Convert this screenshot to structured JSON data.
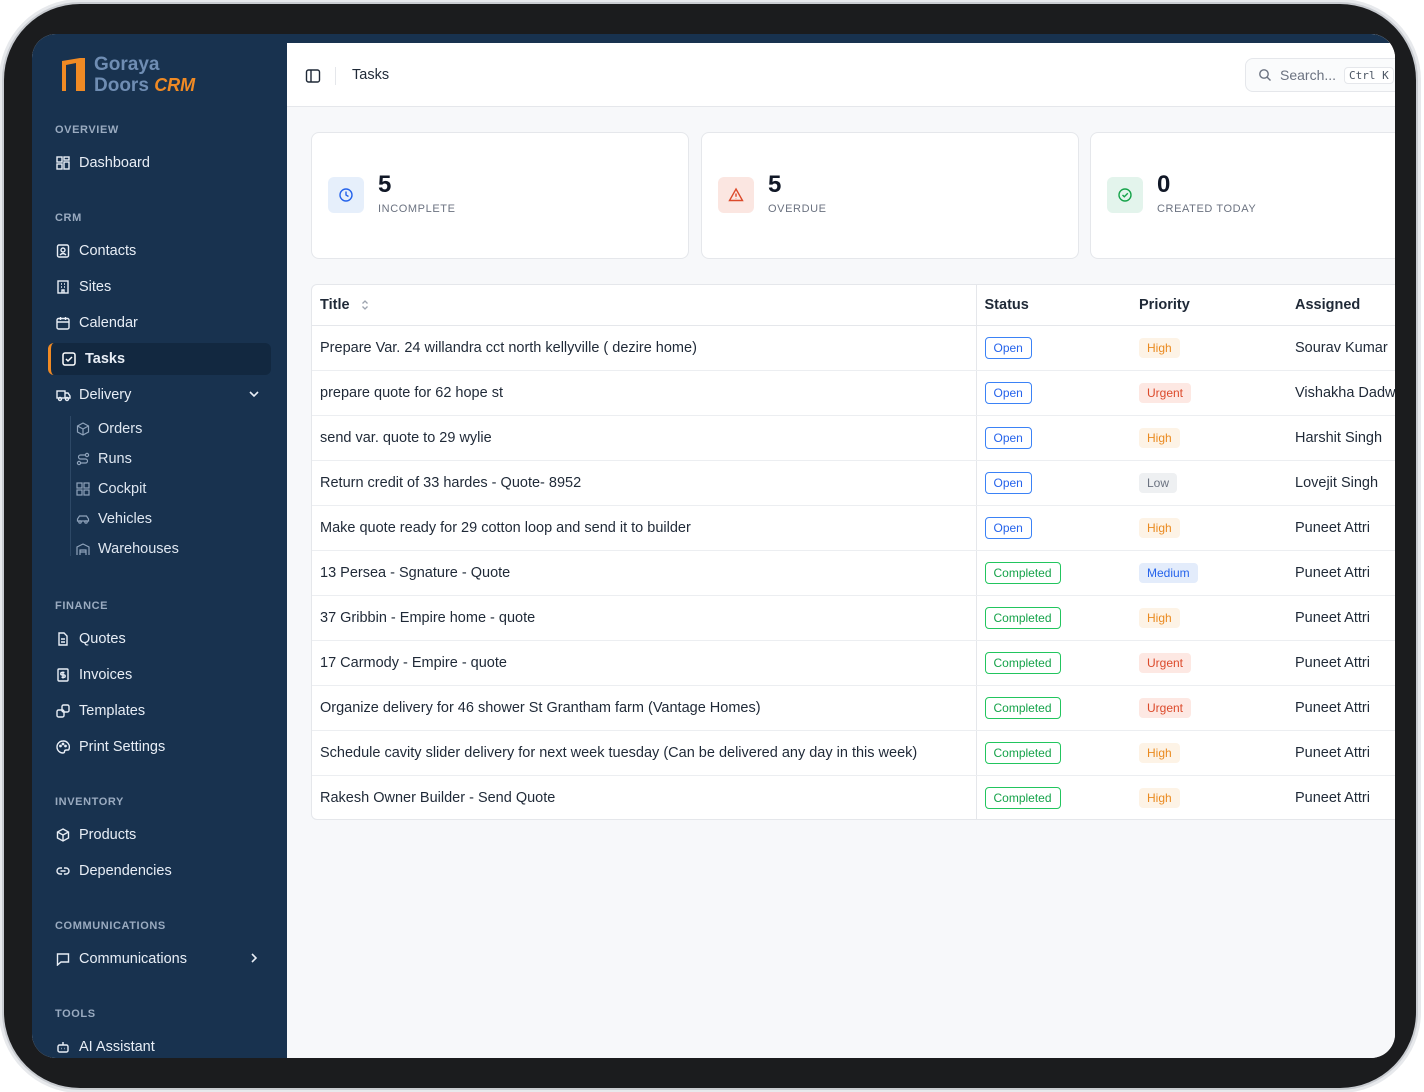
{
  "brand": {
    "line1": "Goraya",
    "line2": "Doors",
    "line2_accent": "CRM"
  },
  "sidebar": {
    "sections": {
      "overview": "OVERVIEW",
      "crm": "CRM",
      "finance": "FINANCE",
      "inventory": "INVENTORY",
      "communications": "COMMUNICATIONS",
      "tools": "TOOLS"
    },
    "items": {
      "dashboard": "Dashboard",
      "contacts": "Contacts",
      "sites": "Sites",
      "calendar": "Calendar",
      "tasks": "Tasks",
      "delivery": "Delivery",
      "orders": "Orders",
      "runs": "Runs",
      "cockpit": "Cockpit",
      "vehicles": "Vehicles",
      "warehouses": "Warehouses",
      "quotes": "Quotes",
      "invoices": "Invoices",
      "templates": "Templates",
      "print_settings": "Print Settings",
      "products": "Products",
      "dependencies": "Dependencies",
      "communications": "Communications",
      "ai_assistant": "AI Assistant"
    },
    "active": "tasks"
  },
  "header": {
    "title": "Tasks",
    "search_placeholder": "Search...",
    "shortcut": "Ctrl K"
  },
  "stats": [
    {
      "value": "5",
      "label": "INCOMPLETE",
      "icon": "clock-icon"
    },
    {
      "value": "5",
      "label": "OVERDUE",
      "icon": "alert-triangle-icon"
    },
    {
      "value": "0",
      "label": "CREATED TODAY",
      "icon": "check-circle-icon"
    }
  ],
  "table": {
    "columns": {
      "title": "Title",
      "status": "Status",
      "priority": "Priority",
      "assigned": "Assigned"
    },
    "rows": [
      {
        "title": "Prepare Var. 24 willandra cct north kellyville ( dezire home)",
        "status": "Open",
        "priority": "High",
        "assigned": "Sourav Kumar"
      },
      {
        "title": "prepare quote for 62 hope st",
        "status": "Open",
        "priority": "Urgent",
        "assigned": "Vishakha Dadw"
      },
      {
        "title": "send var. quote to 29 wylie",
        "status": "Open",
        "priority": "High",
        "assigned": "Harshit Singh"
      },
      {
        "title": "Return credit of 33 hardes - Quote- 8952",
        "status": "Open",
        "priority": "Low",
        "assigned": "Lovejit Singh"
      },
      {
        "title": "Make quote ready for 29 cotton loop and send it to builder",
        "status": "Open",
        "priority": "High",
        "assigned": "Puneet Attri"
      },
      {
        "title": "13 Persea - Sgnature - Quote",
        "status": "Completed",
        "priority": "Medium",
        "assigned": "Puneet Attri"
      },
      {
        "title": "37 Gribbin - Empire home - quote",
        "status": "Completed",
        "priority": "High",
        "assigned": "Puneet Attri"
      },
      {
        "title": "17 Carmody - Empire - quote",
        "status": "Completed",
        "priority": "Urgent",
        "assigned": "Puneet Attri"
      },
      {
        "title": "Organize delivery for 46 shower St Grantham farm (Vantage Homes)",
        "status": "Completed",
        "priority": "Urgent",
        "assigned": "Puneet Attri"
      },
      {
        "title": "Schedule cavity slider delivery for next week tuesday (Can be delivered any day in this week)",
        "status": "Completed",
        "priority": "High",
        "assigned": "Puneet Attri"
      },
      {
        "title": "Rakesh Owner Builder - Send Quote",
        "status": "Completed",
        "priority": "High",
        "assigned": "Puneet Attri"
      }
    ]
  },
  "colors": {
    "sidebar_bg": "#18324f",
    "accent": "#f08a24",
    "open": "#2563eb",
    "completed": "#16a34a",
    "high": "#ea8a1f",
    "urgent": "#dc4a2b"
  }
}
